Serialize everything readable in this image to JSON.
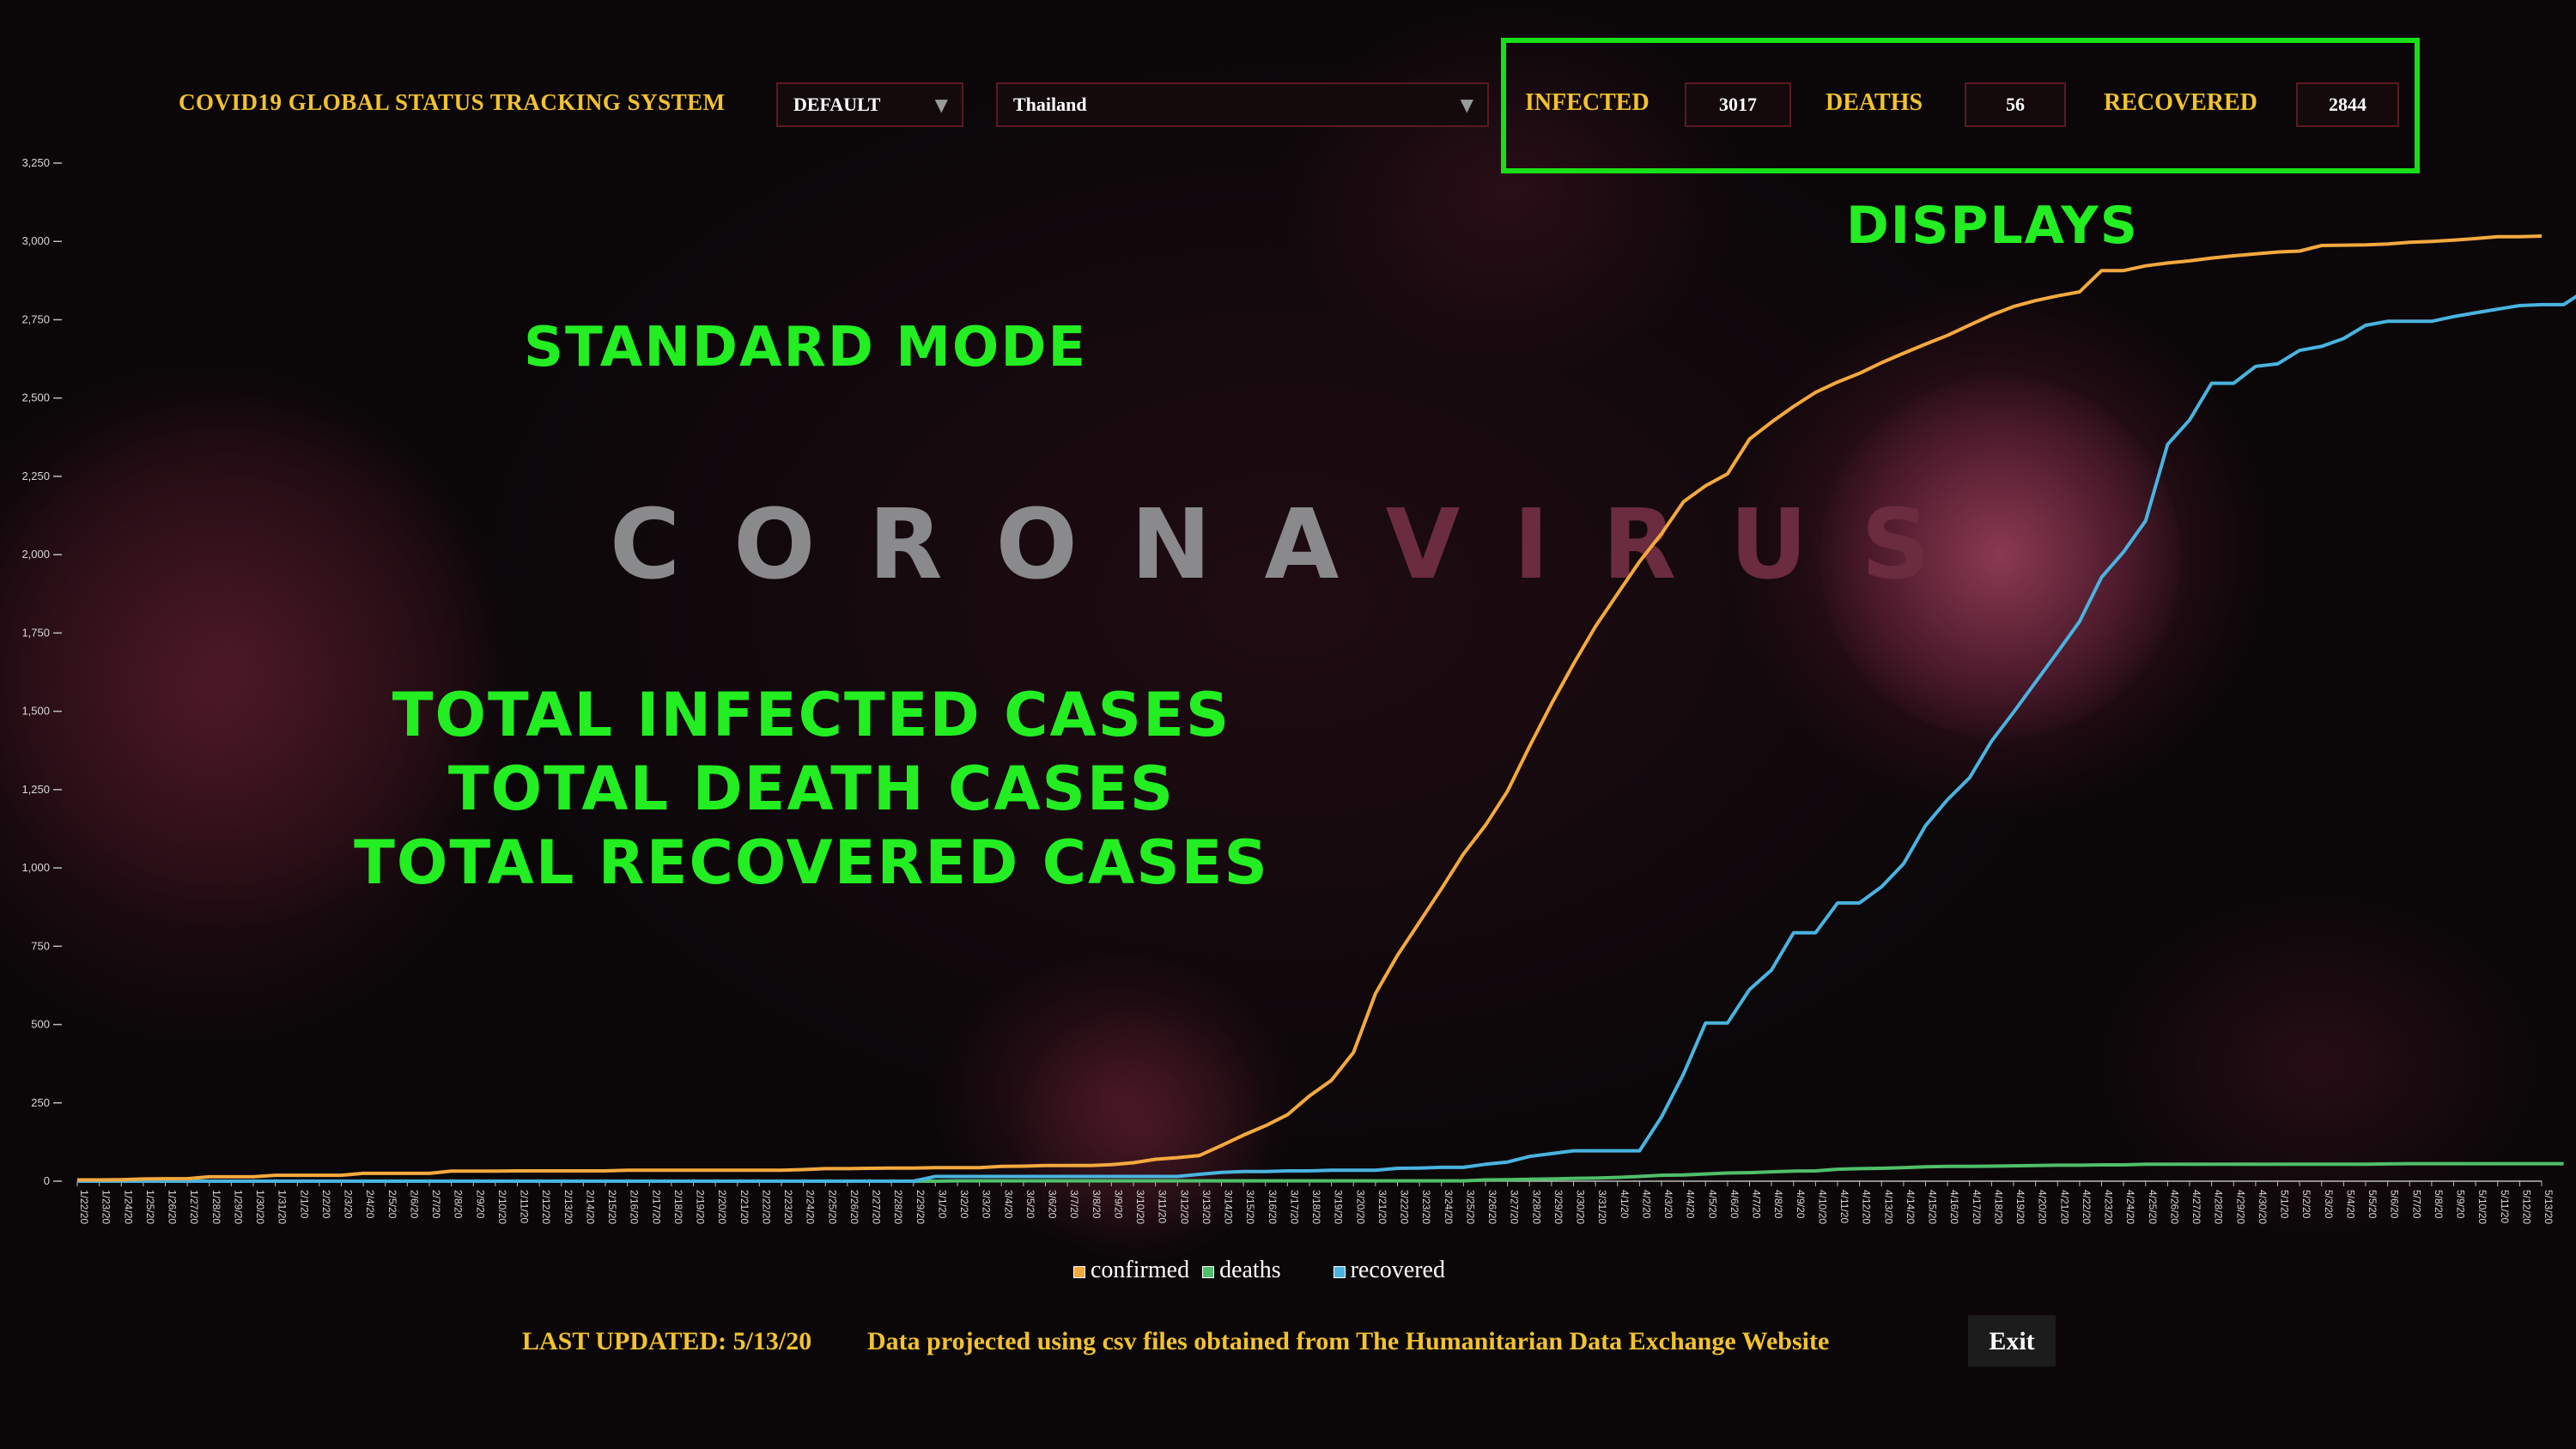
{
  "app": {
    "title": "COVID19 GLOBAL STATUS TRACKING SYSTEM"
  },
  "controls": {
    "mode_select": {
      "value": "DEFAULT"
    },
    "country_select": {
      "value": "Thailand"
    }
  },
  "stats": {
    "infected": {
      "label": "INFECTED",
      "value": "3017"
    },
    "deaths": {
      "label": "DEATHS",
      "value": "56"
    },
    "recovered": {
      "label": "RECOVERED",
      "value": "2844"
    }
  },
  "annotations": {
    "displays": "DISPLAYS",
    "standard_mode": "STANDARD MODE",
    "totals": [
      "TOTAL INFECTED CASES",
      "TOTAL DEATH CASES",
      "TOTAL RECOVERED CASES"
    ]
  },
  "brand": {
    "part1": "CORONA",
    "part2": "VIRUS"
  },
  "colors": {
    "accent_yellow": "#f2c230",
    "annotation_green": "#22ee22",
    "confirmed": "#f4a93e",
    "deaths": "#4fbf6a",
    "recovered": "#4ab3e0",
    "panel_border": "#5a1a22"
  },
  "icons": {
    "dropdown": "chevron-down-icon"
  },
  "chart_data": {
    "type": "line",
    "x_start": "1/22/20",
    "x_end": "5/13/20",
    "y_ticks": [
      "0",
      "250",
      "500",
      "750",
      "1,000",
      "1,250",
      "1,500",
      "1,750",
      "2,000",
      "2,250",
      "2,500",
      "2,750",
      "3,000",
      "3,250"
    ],
    "ylim": [
      0,
      3250
    ],
    "series": [
      {
        "name": "confirmed",
        "color": "#f4a93e",
        "values": [
          4,
          4,
          5,
          7,
          8,
          8,
          14,
          14,
          14,
          19,
          19,
          19,
          19,
          25,
          25,
          25,
          25,
          32,
          32,
          32,
          33,
          33,
          33,
          33,
          33,
          35,
          35,
          35,
          35,
          35,
          35,
          35,
          35,
          37,
          40,
          40,
          41,
          42,
          42,
          43,
          43,
          43,
          47,
          48,
          50,
          50,
          50,
          53,
          59,
          70,
          75,
          82,
          114,
          147,
          177,
          212,
          272,
          322,
          411,
          599,
          721,
          827,
          934,
          1045,
          1136,
          1245,
          1388,
          1524,
          1651,
          1771,
          1875,
          1978,
          2067,
          2169,
          2220,
          2258,
          2369,
          2423,
          2473,
          2518,
          2551,
          2579,
          2613,
          2643,
          2672,
          2700,
          2733,
          2765,
          2792,
          2811,
          2826,
          2839,
          2907,
          2907,
          2922,
          2931,
          2938,
          2947,
          2954,
          2960,
          2966,
          2969,
          2987,
          2988,
          2989,
          2992,
          2997,
          3000,
          3004,
          3009,
          3015,
          3015,
          3017
        ]
      },
      {
        "name": "deaths",
        "color": "#4fbf6a",
        "values": [
          0,
          0,
          0,
          0,
          0,
          0,
          0,
          0,
          0,
          0,
          0,
          0,
          0,
          0,
          0,
          0,
          0,
          0,
          0,
          0,
          0,
          0,
          0,
          0,
          0,
          0,
          0,
          0,
          0,
          0,
          0,
          0,
          0,
          0,
          0,
          0,
          0,
          0,
          0,
          0,
          1,
          1,
          1,
          1,
          1,
          1,
          1,
          1,
          1,
          1,
          1,
          1,
          1,
          1,
          1,
          1,
          1,
          1,
          1,
          1,
          1,
          1,
          1,
          1,
          4,
          5,
          6,
          7,
          9,
          10,
          12,
          15,
          19,
          20,
          23,
          26,
          27,
          30,
          32,
          33,
          38,
          40,
          41,
          43,
          46,
          47,
          47,
          48,
          49,
          50,
          51,
          51,
          52,
          52,
          54,
          54,
          54,
          54,
          54,
          54,
          54,
          54,
          54,
          54,
          54,
          55,
          56,
          56,
          56,
          56,
          56,
          56,
          56,
          56
        ]
      },
      {
        "name": "recovered",
        "color": "#4ab3e0",
        "values": [
          0,
          0,
          0,
          0,
          0,
          0,
          0,
          0,
          0,
          0,
          0,
          0,
          0,
          0,
          0,
          0,
          0,
          0,
          0,
          0,
          0,
          0,
          0,
          0,
          0,
          0,
          0,
          0,
          0,
          0,
          0,
          0,
          0,
          0,
          0,
          0,
          0,
          0,
          0,
          15,
          15,
          15,
          15,
          15,
          15,
          15,
          15,
          15,
          15,
          15,
          15,
          22,
          28,
          31,
          31,
          33,
          33,
          35,
          35,
          35,
          41,
          42,
          44,
          44,
          54,
          61,
          79,
          88,
          97,
          97,
          97,
          97,
          205,
          342,
          505,
          505,
          612,
          674,
          793,
          793,
          888,
          888,
          940,
          1013,
          1135,
          1218,
          1288,
          1405,
          1497,
          1593,
          1689,
          1787,
          1928,
          2009,
          2108,
          2352,
          2430,
          2547,
          2547,
          2601,
          2609,
          2652,
          2665,
          2690,
          2732,
          2745,
          2745,
          2745,
          2760,
          2772,
          2784,
          2795,
          2798,
          2798,
          2844
        ]
      }
    ],
    "legend": [
      "confirmed",
      "deaths",
      "recovered"
    ],
    "legend_placement": "bottom"
  },
  "footer": {
    "last_updated": "LAST UPDATED: 5/13/20",
    "source": "Data projected using csv files obtained from The Humanitarian Data Exchange Website",
    "exit_label": "Exit"
  }
}
